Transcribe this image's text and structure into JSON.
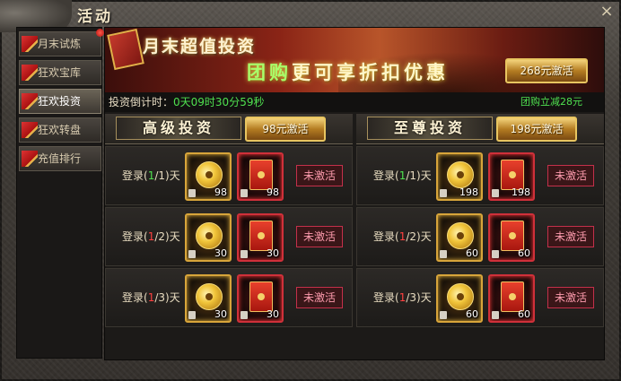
{
  "window": {
    "title": "活动",
    "close_icon": "×"
  },
  "sidebar": {
    "items": [
      {
        "label": "月末试炼",
        "active": false,
        "has_dot": true
      },
      {
        "label": "狂欢宝库",
        "active": false,
        "has_dot": false
      },
      {
        "label": "狂欢投资",
        "active": true,
        "has_dot": false
      },
      {
        "label": "狂欢转盘",
        "active": false,
        "has_dot": false
      },
      {
        "label": "充值排行",
        "active": false,
        "has_dot": false
      }
    ]
  },
  "banner": {
    "title": "月末超值投资",
    "subtitle_highlight": "团购",
    "subtitle_rest": "更可享折扣优惠",
    "button_label": "268元激活",
    "discount_note": "团购立减28元"
  },
  "countdown": {
    "label": "投资倒计时：",
    "value": "0天09时30分59秒"
  },
  "columns": [
    {
      "title": "高级投资",
      "button_label": "98元激活",
      "rows": [
        {
          "prefix": "登录(",
          "done": "1",
          "sep": "/1)天",
          "done_color": "green",
          "coin_qty": "98",
          "envelope_qty": "98",
          "status": "未激活"
        },
        {
          "prefix": "登录(",
          "done": "1",
          "sep": "/2)天",
          "done_color": "red",
          "coin_qty": "30",
          "envelope_qty": "30",
          "status": "未激活"
        },
        {
          "prefix": "登录(",
          "done": "1",
          "sep": "/3)天",
          "done_color": "red",
          "coin_qty": "30",
          "envelope_qty": "30",
          "status": "未激活"
        }
      ]
    },
    {
      "title": "至尊投资",
      "button_label": "198元激活",
      "rows": [
        {
          "prefix": "登录(",
          "done": "1",
          "sep": "/1)天",
          "done_color": "green",
          "coin_qty": "198",
          "envelope_qty": "198",
          "status": "未激活"
        },
        {
          "prefix": "登录(",
          "done": "1",
          "sep": "/2)天",
          "done_color": "red",
          "coin_qty": "60",
          "envelope_qty": "60",
          "status": "未激活"
        },
        {
          "prefix": "登录(",
          "done": "1",
          "sep": "/3)天",
          "done_color": "red",
          "coin_qty": "60",
          "envelope_qty": "60",
          "status": "未激活"
        }
      ]
    }
  ]
}
